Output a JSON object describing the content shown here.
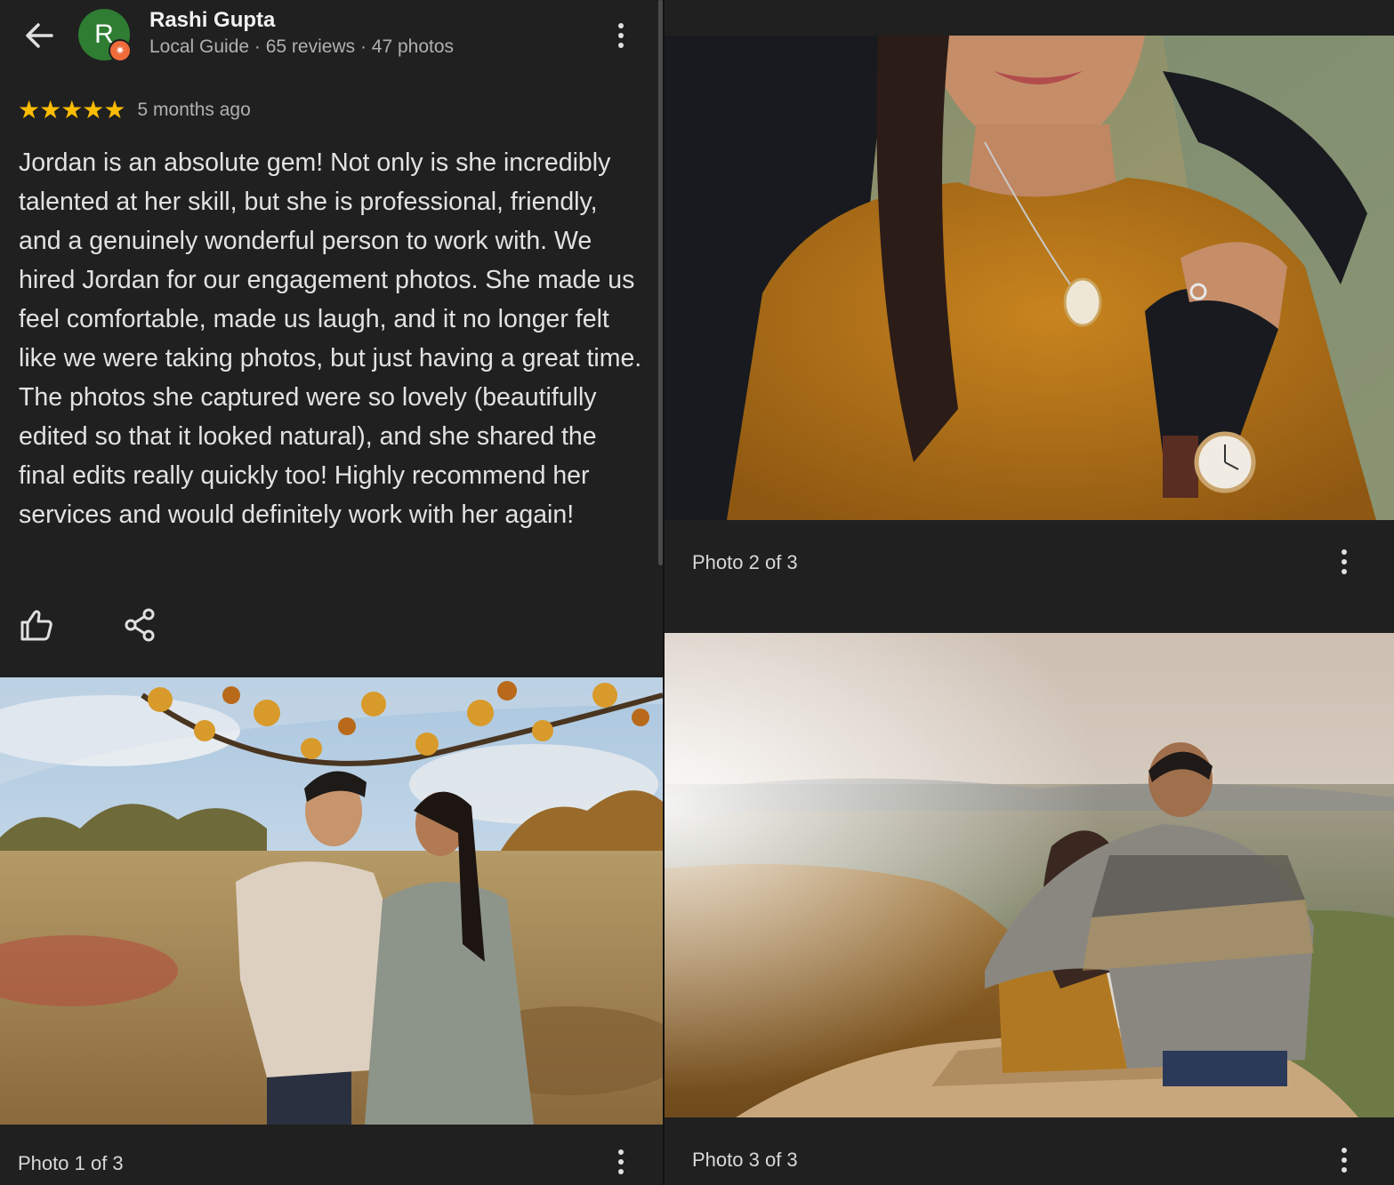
{
  "review": {
    "reviewer_name": "Rashi Gupta",
    "avatar_initial": "R",
    "reviewer_meta": "Local Guide · 65 reviews · 47 photos",
    "rating": 5,
    "stars": "★★★★★",
    "date": "5 months ago",
    "text": "Jordan is an absolute gem! Not only is she incredibly talented at her skill, but she is professional, friendly, and a genuinely wonderful person to work with. We hired Jordan for our engagement photos. She made us feel comfortable, made us laugh, and it no longer felt like we were taking photos, but just having a great time. The photos she captured were so lovely (beautifully edited so that it looked natural), and she shared the final edits really quickly too! Highly recommend her services and would definitely work with her again!"
  },
  "actions": {
    "back_icon": "arrow-left-icon",
    "menu_icon": "more-vert-icon",
    "like_icon": "thumb-up-icon",
    "share_icon": "share-icon"
  },
  "photos": [
    {
      "caption": "Photo 1 of 3"
    },
    {
      "caption": "Photo 2 of 3"
    },
    {
      "caption": "Photo 3 of 3"
    }
  ],
  "colors": {
    "background": "#202020",
    "star": "#fbbc04",
    "avatar": "#2e7d32",
    "guide_badge": "#ef6c3a"
  }
}
